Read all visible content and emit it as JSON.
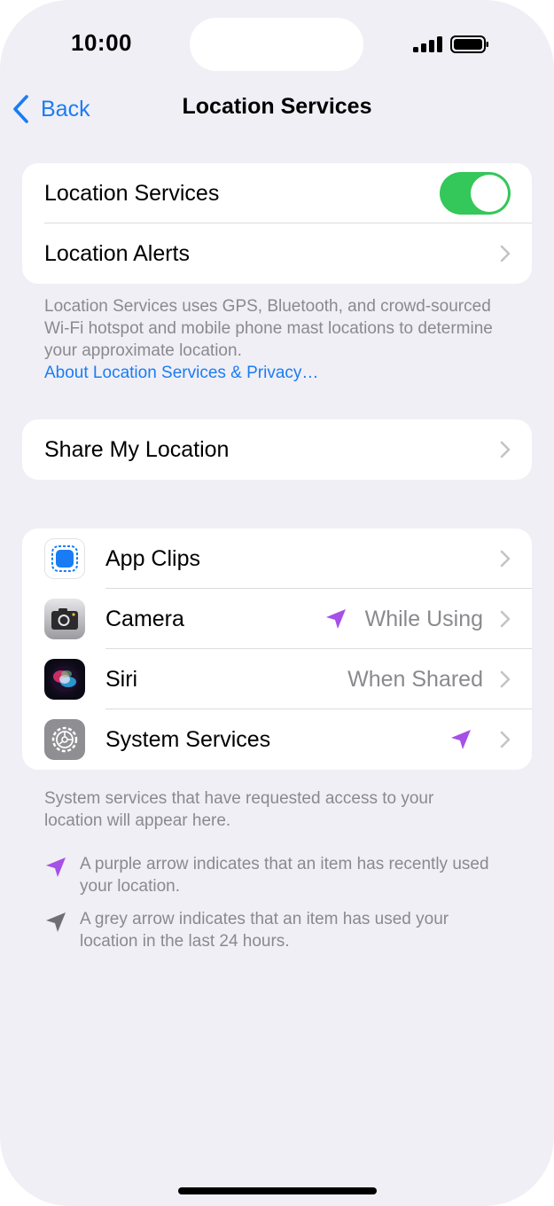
{
  "status_bar": {
    "time": "10:00"
  },
  "nav": {
    "back_label": "Back",
    "title": "Location Services"
  },
  "main_group": {
    "location_services": {
      "label": "Location Services",
      "enabled": true
    },
    "location_alerts": {
      "label": "Location Alerts"
    }
  },
  "description": {
    "text": "Location Services uses GPS, Bluetooth, and crowd-sourced Wi-Fi hotspot and mobile phone mast locations to determine your approximate location.",
    "link": "About Location Services & Privacy…"
  },
  "share": {
    "label": "Share My Location"
  },
  "apps": [
    {
      "label": "App Clips",
      "value": "",
      "icon": "app-clips-icon"
    },
    {
      "label": "Camera",
      "value": "While Using",
      "icon": "camera-icon",
      "arrow": "purple"
    },
    {
      "label": "Siri",
      "value": "When Shared",
      "icon": "siri-icon"
    },
    {
      "label": "System Services",
      "value": "",
      "icon": "gear-icon",
      "arrow": "purple"
    }
  ],
  "system_note": "System services that have requested access to your location will appear here.",
  "legend": {
    "purple": "A purple arrow indicates that an item has recently used your location.",
    "grey": "A grey arrow indicates that an item has used your location in the last 24 hours."
  },
  "colors": {
    "accent": "#1a7cf5",
    "toggle_on": "#34c759",
    "purple_arrow": "#a550e6",
    "grey_arrow": "#6e6e73"
  }
}
